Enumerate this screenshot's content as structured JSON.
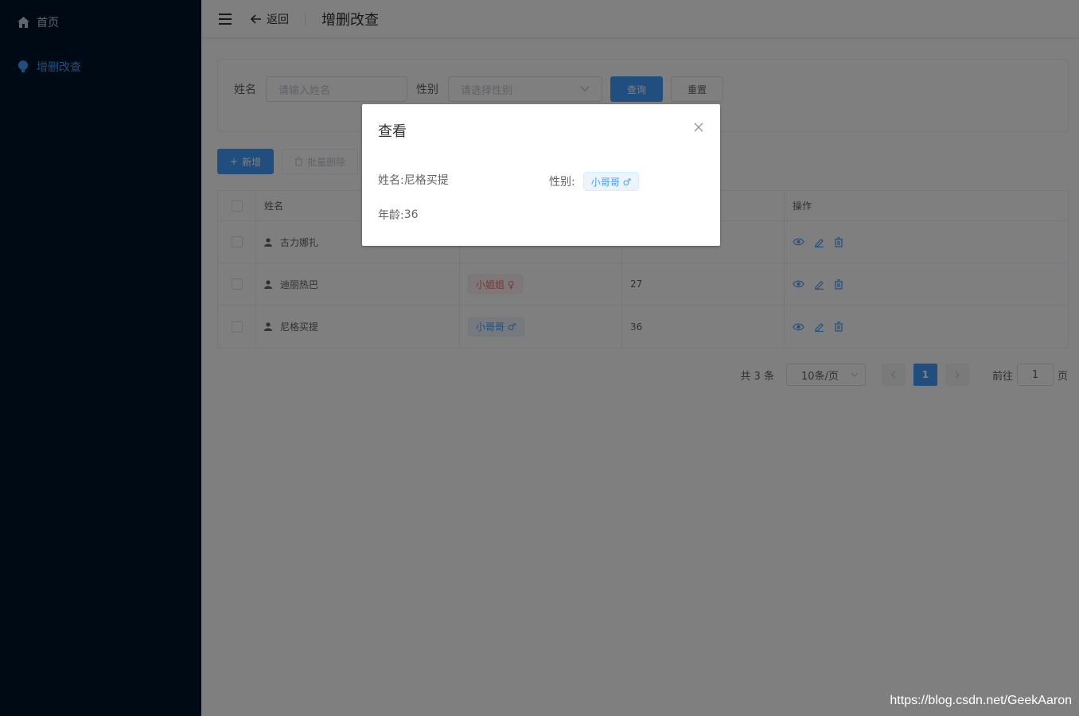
{
  "sidebar": {
    "items": [
      {
        "label": "首页",
        "icon": "home-icon"
      },
      {
        "label": "增删改查",
        "icon": "bulb-icon"
      }
    ]
  },
  "header": {
    "back_label": "返回",
    "title": "增删改查"
  },
  "search": {
    "name_label": "姓名",
    "name_placeholder": "请输入姓名",
    "gender_label": "性别",
    "gender_placeholder": "请选择性别",
    "query_label": "查询",
    "reset_label": "重置"
  },
  "toolbar": {
    "add_label": "新增",
    "batch_delete_label": "批量删除"
  },
  "table": {
    "headers": [
      "姓名",
      "",
      "",
      "操作"
    ],
    "rows": [
      {
        "name": "古力娜扎",
        "gender": "",
        "age": ""
      },
      {
        "name": "迪丽热巴",
        "gender": "小姐姐 ♀",
        "age": "27"
      },
      {
        "name": "尼格买提",
        "gender": "小哥哥 ♂",
        "age": "36"
      }
    ]
  },
  "pagination": {
    "total": "共 3 条",
    "page_size": "10条/页",
    "current": "1",
    "goto_prefix": "前往",
    "goto_value": "1",
    "goto_suffix": "页"
  },
  "dialog": {
    "title": "查看",
    "name_label": "姓名:",
    "name_value": "尼格买提",
    "gender_label": "性别:",
    "gender_value": "小哥哥 ♂",
    "age_label": "年龄:",
    "age_value": "36"
  },
  "watermark": "https://blog.csdn.net/GeekAaron",
  "colors": {
    "sidebar_bg": "#001529",
    "primary": "#409eff",
    "male_tag": "#409eff",
    "female_tag": "#f56c6c"
  }
}
